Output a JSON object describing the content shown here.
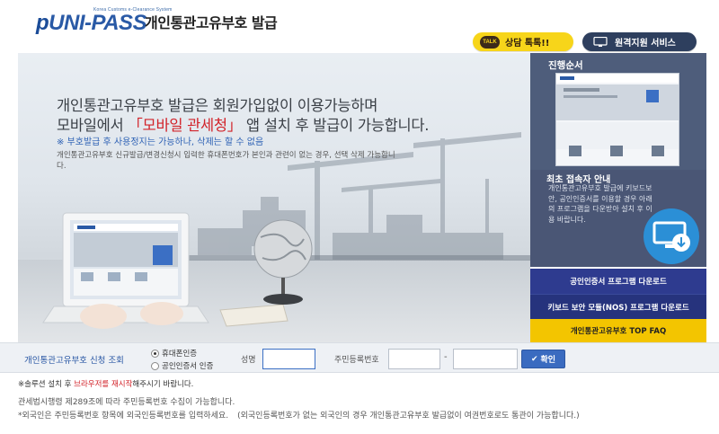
{
  "header": {
    "logo_tagline": "Korea Customs e-Clearance System",
    "logo_text": "UNI-PASS",
    "logo_prefix": "p",
    "title": "개인통관고유부호 발급",
    "talk_badge": "TALK",
    "talk_button": "상담 톡톡!!",
    "remote_button": "원격지원 서비스"
  },
  "hero": {
    "line1": "개인통관고유부호 발급은 회원가입없이 이용가능하며",
    "line2_pre": "모바일에서 ",
    "line2_highlight": "「모바일 관세청」",
    "line2_post": " 앱 설치 후 발급이 가능합니다.",
    "note": "※ 부호발급 후 사용정지는 가능하나, 삭제는 할 수 없음",
    "desc": "개인통관고유부호 신규발급/변경신청시 입력한 휴대폰번호가 본인과 관련이 없는 경우, 선택 삭제 가능합니다."
  },
  "sidebar": {
    "progress_title": "진행순서",
    "notice_title": "최초 접속자 안내",
    "notice_text": "개인통관고유부호 발급에 키보드보안, 공인인증서를 이용할 경우 아래의 프로그램을 다운받아 설치 후 이용 바랍니다.",
    "buttons": [
      "공인인증서 프로그램 다운로드",
      "키보드 보안 모듈(NOS) 프로그램 다운로드",
      "개인통관고유부호 TOP FAQ"
    ]
  },
  "lookup": {
    "title": "개인통관고유부호 신청 조회",
    "options": [
      "휴대폰인증",
      "공인인증서 인증"
    ],
    "selected": "휴대폰인증",
    "name_label": "성명",
    "name_value": "",
    "rrn_label": "주민등록번호",
    "rrn_sep": "-",
    "confirm_label": "확인"
  },
  "notes": {
    "line1_pre": "※솔루션 설치 후 ",
    "line1_highlight": "브라우저를 재시작",
    "line1_post": "해주시기 바랍니다.",
    "line2": "관세법시행령 제289조에 따라 주민등록번호 수집이 가능합니다.",
    "line3": "*외국인은 주민등록번호 항목에 외국인등록번호를 입력하세요.",
    "line3_paren": "(외국인등록번호가 없는 외국인의 경우 개인통관고유부호 발급없이 여권번호로도 통관이 가능합니다.)"
  },
  "colors": {
    "brand_blue": "#2a5aa6",
    "highlight_red": "#d2232a",
    "talk_yellow": "#f7d51a",
    "sidebar_navy": "#4e5d7b",
    "faq_yellow": "#f3c500"
  }
}
